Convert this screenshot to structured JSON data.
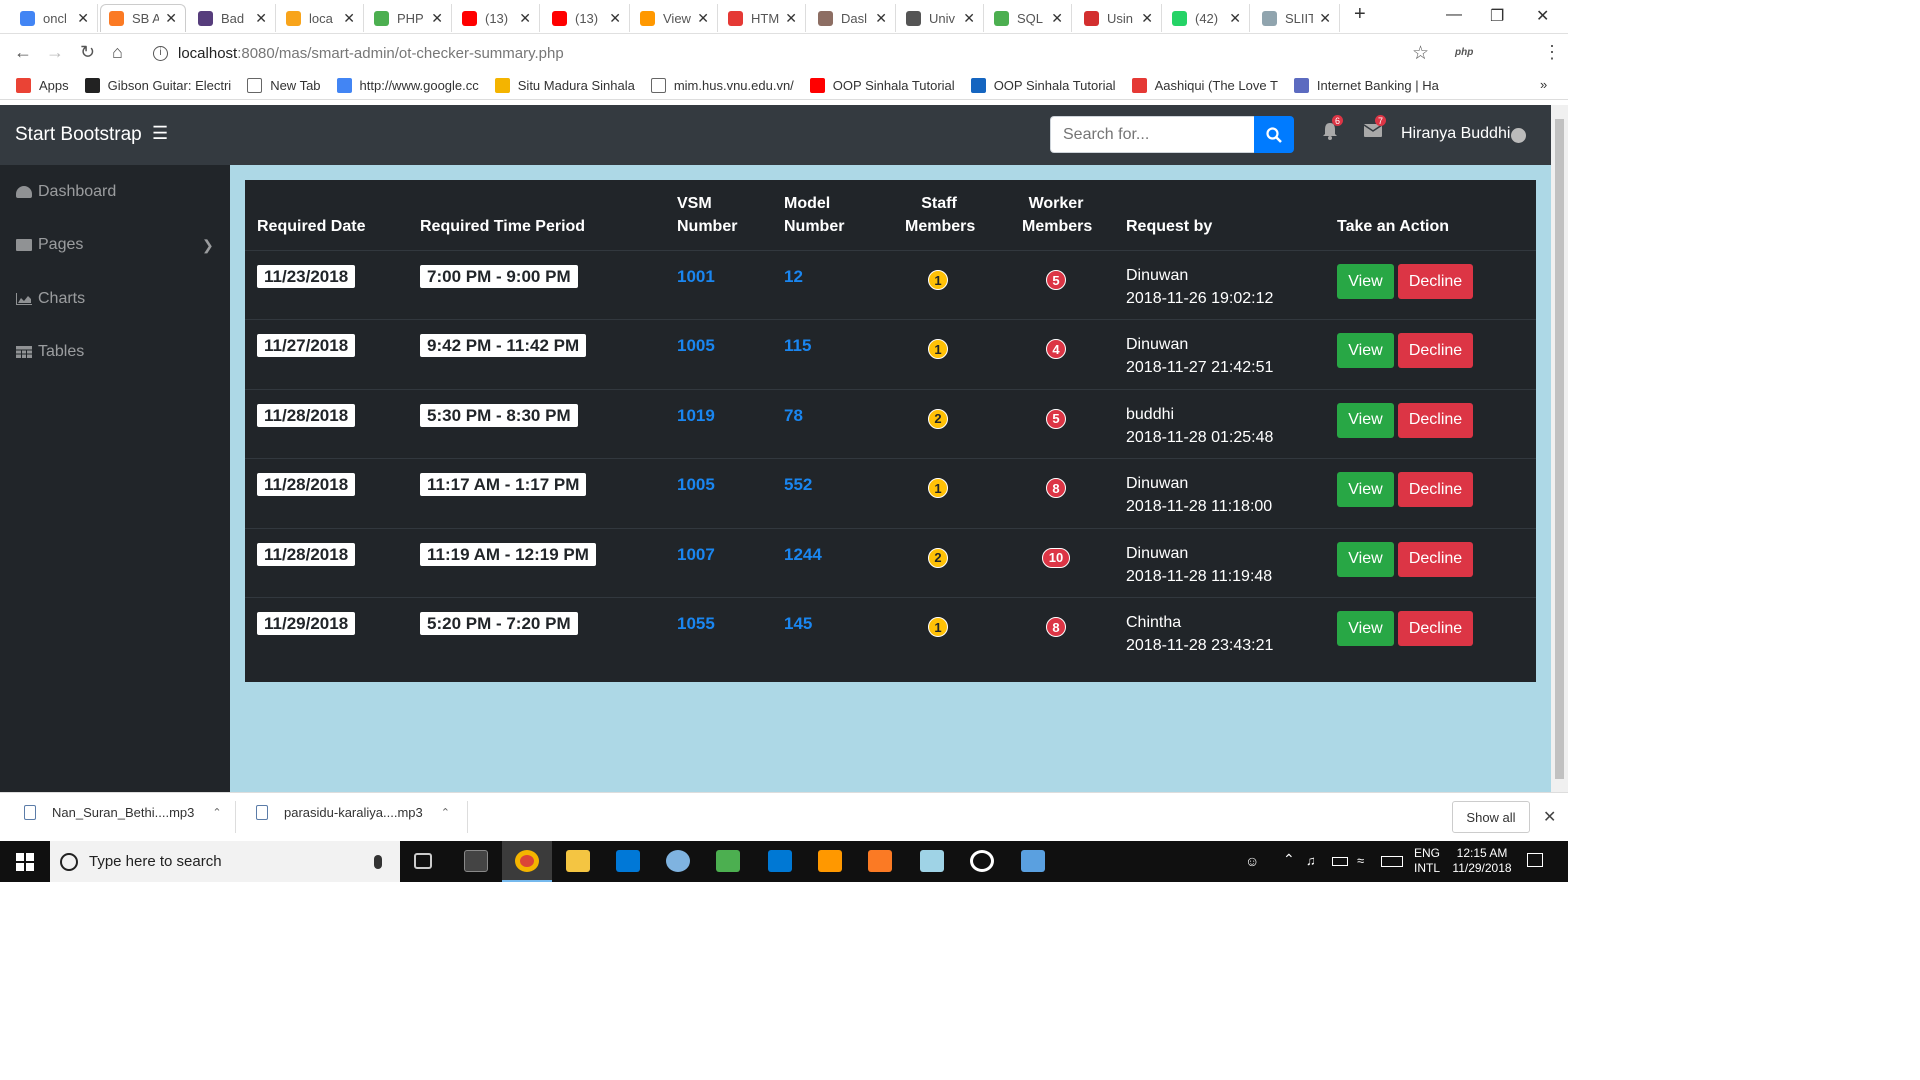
{
  "browser": {
    "tabs": [
      {
        "title": "oncl",
        "color": "#4285f4"
      },
      {
        "title": "SB A",
        "color": "#fb7a24"
      },
      {
        "title": "Bad",
        "color": "#563d7c"
      },
      {
        "title": "loca",
        "color": "#f8a41b"
      },
      {
        "title": "PHP",
        "color": "#4caf50"
      },
      {
        "title": "(13)",
        "color": "#ff0000"
      },
      {
        "title": "(13)",
        "color": "#ff0000"
      },
      {
        "title": "View",
        "color": "#ff9800"
      },
      {
        "title": "HTM",
        "color": "#e53935"
      },
      {
        "title": "Dasl",
        "color": "#8d6e63"
      },
      {
        "title": "Univ",
        "color": "#555555"
      },
      {
        "title": "SQL",
        "color": "#4caf50"
      },
      {
        "title": "Usin",
        "color": "#d32f2f"
      },
      {
        "title": "(42)",
        "color": "#25d366"
      },
      {
        "title": "SLIIT",
        "color": "#90a4ae"
      }
    ],
    "url_host": "localhost",
    "url_rest": ":8080/mas/smart-admin/ot-checker-summary.php",
    "bookmarks": [
      {
        "label": "Apps",
        "color": "#ea4335"
      },
      {
        "label": "Gibson Guitar: Electri",
        "color": "#222222"
      },
      {
        "label": "New Tab",
        "color": "#ffffff"
      },
      {
        "label": "http://www.google.cc",
        "color": "#4285f4"
      },
      {
        "label": "Situ Madura Sinhala",
        "color": "#f4b400"
      },
      {
        "label": "mim.hus.vnu.edu.vn/",
        "color": "#ffffff"
      },
      {
        "label": "OOP Sinhala Tutorial",
        "color": "#ff0000"
      },
      {
        "label": "OOP Sinhala Tutorial",
        "color": "#1565c0"
      },
      {
        "label": "Aashiqui (The Love T",
        "color": "#e53935"
      },
      {
        "label": "Internet Banking | Ha",
        "color": "#5c6bc0"
      }
    ]
  },
  "navbar": {
    "brand": "Start Bootstrap",
    "search_placeholder": "Search for...",
    "alerts_count": "6",
    "messages_count": "7",
    "username": "Hiranya Buddhi"
  },
  "sidebar": {
    "items": [
      {
        "label": "Dashboard"
      },
      {
        "label": "Pages"
      },
      {
        "label": "Charts"
      },
      {
        "label": "Tables"
      }
    ]
  },
  "table": {
    "headers": {
      "date": "Required Date",
      "period": "Required Time Period",
      "vsm_1": "VSM",
      "vsm_2": "Number",
      "model_1": "Model",
      "model_2": "Number",
      "staff_1": "Staff",
      "staff_2": "Members",
      "worker_1": "Worker",
      "worker_2": "Members",
      "request": "Request by",
      "action": "Take an Action"
    },
    "rows": [
      {
        "date": "11/23/2018",
        "period": "7:00 PM - 9:00 PM",
        "vsm": "1001",
        "model": "12",
        "staff": "1",
        "worker": "5",
        "name": "Dinuwan",
        "timestamp": "2018-11-26 19:02:12"
      },
      {
        "date": "11/27/2018",
        "period": "9:42 PM - 11:42 PM",
        "vsm": "1005",
        "model": "115",
        "staff": "1",
        "worker": "4",
        "name": "Dinuwan",
        "timestamp": "2018-11-27 21:42:51"
      },
      {
        "date": "11/28/2018",
        "period": "5:30 PM - 8:30 PM",
        "vsm": "1019",
        "model": "78",
        "staff": "2",
        "worker": "5",
        "name": "buddhi",
        "timestamp": "2018-11-28 01:25:48"
      },
      {
        "date": "11/28/2018",
        "period": "11:17 AM - 1:17 PM",
        "vsm": "1005",
        "model": "552",
        "staff": "1",
        "worker": "8",
        "name": "Dinuwan",
        "timestamp": "2018-11-28 11:18:00"
      },
      {
        "date": "11/28/2018",
        "period": "11:19 AM - 12:19 PM",
        "vsm": "1007",
        "model": "1244",
        "staff": "2",
        "worker": "10",
        "name": "Dinuwan",
        "timestamp": "2018-11-28 11:19:48"
      },
      {
        "date": "11/29/2018",
        "period": "5:20 PM - 7:20 PM",
        "vsm": "1055",
        "model": "145",
        "staff": "1",
        "worker": "8",
        "name": "Chintha",
        "timestamp": "2018-11-28 23:43:21"
      }
    ],
    "view_label": "View",
    "decline_label": "Decline"
  },
  "downloads": {
    "items": [
      {
        "name": "Nan_Suran_Bethi....mp3"
      },
      {
        "name": "parasidu-karaliya....mp3"
      }
    ],
    "show_all": "Show all"
  },
  "taskbar": {
    "search_placeholder": "Type here to search",
    "lang_1": "ENG",
    "lang_2": "INTL",
    "time": "12:15 AM",
    "date": "11/29/2018"
  },
  "colors": {
    "navbar": "#343a40",
    "sidebar": "#212529",
    "content_bg": "#add8e6",
    "link_blue": "#1a86f0",
    "success": "#28a745",
    "danger": "#dc3545",
    "warning": "#ffc107"
  }
}
